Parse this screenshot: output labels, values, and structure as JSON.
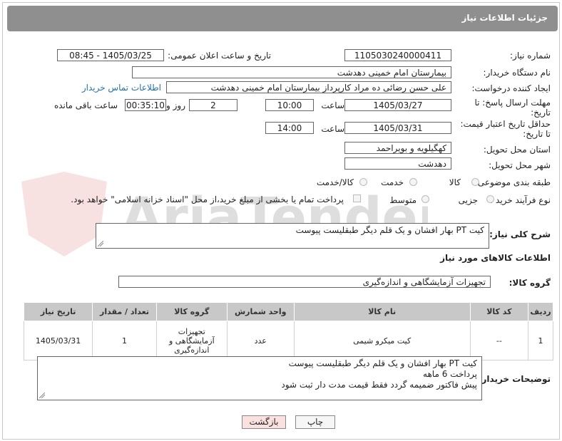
{
  "header": {
    "title": "جزئیات اطلاعات نیاز"
  },
  "fields": {
    "need_number_label": "شماره نیاز:",
    "need_number": "1105030240000411",
    "announce_label": "تاریخ و ساعت اعلان عمومی:",
    "announce_value": "1405/03/25 - 08:45",
    "buyer_org_label": "نام دستگاه خریدار:",
    "buyer_org": "بیمارستان امام خمینی دهدشت",
    "creator_label": "ایجاد کننده درخواست:",
    "creator": "علی حسن رضائی ده مراد کارپرداز بیمارستان امام خمینی دهدشت",
    "buyer_contact_link": "اطلاعات تماس خریدار",
    "deadline_label_1": "مهلت ارسال پاسخ: تا",
    "deadline_label_2": "تاریخ:",
    "deadline_date": "1405/03/27",
    "hour_label": "ساعت",
    "deadline_time": "10:00",
    "days_value": "2",
    "days_label": "روز و",
    "remaining_time": "00:35:10",
    "remaining_label": "ساعت باقی مانده",
    "validity_label_1": "حداقل تاریخ اعتبار قیمت:",
    "validity_label_2": "تا تاریخ:",
    "validity_date": "1405/03/31",
    "validity_hour_label": "ساعت",
    "validity_time": "14:00",
    "province_label": "استان محل تحویل:",
    "province": "کهگیلویه و بویراحمد",
    "city_label": "شهر محل تحویل:",
    "city": "دهدشت",
    "category_label": "طبقه بندی موضوعی:",
    "category_options": [
      "کالا",
      "خدمت",
      "کالا/خدمت"
    ],
    "process_label": "نوع فرآیند خرید :",
    "process_options": [
      "جزیی",
      "متوسط"
    ],
    "payment_note": "پرداخت تمام یا بخشی از مبلغ خرید،از محل \"اسناد خزانه اسلامی\" خواهد بود."
  },
  "description": {
    "label": "شرح کلی نیاز:",
    "value": "کیت PT بهار افشان و یک قلم دیگر طبقلیست پیوست"
  },
  "goods": {
    "section_title": "اطلاعات کالاهای مورد نیاز",
    "group_label": "گروه کالا:",
    "group_value": "تجهیزات آزمایشگاهی و اندازه‌گیری"
  },
  "table": {
    "headers": [
      "ردیف",
      "کد کالا",
      "نام کالا",
      "واحد شمارش",
      "گروه کالا",
      "تعداد / مقدار",
      "تاریخ نیاز"
    ],
    "rows": [
      [
        "1",
        "--",
        "کیت میکرو شیمی",
        "عدد",
        "تجهیزات آزمایشگاهی و اندازه‌گیری",
        "1",
        "1405/03/31"
      ]
    ]
  },
  "buyer_notes": {
    "label": "توضیحات خریدار:",
    "lines": [
      "کیت PT بهار افشان و یک قلم دیگر طبقلیست پیوست",
      "پرداخت 6 ماهه",
      "پیش فاکتور ضمیمه گردد فقط قیمت مدت دار ثبت شود"
    ]
  },
  "buttons": {
    "print": "چاپ",
    "back": "بازگشت"
  },
  "watermark": "AriaTender.net",
  "colors": {
    "header_bg": "#8f8f8f",
    "link": "#1f6fbf",
    "back_btn_bg": "#fbe0e0",
    "table_header_bg": "#c8c8c8"
  }
}
